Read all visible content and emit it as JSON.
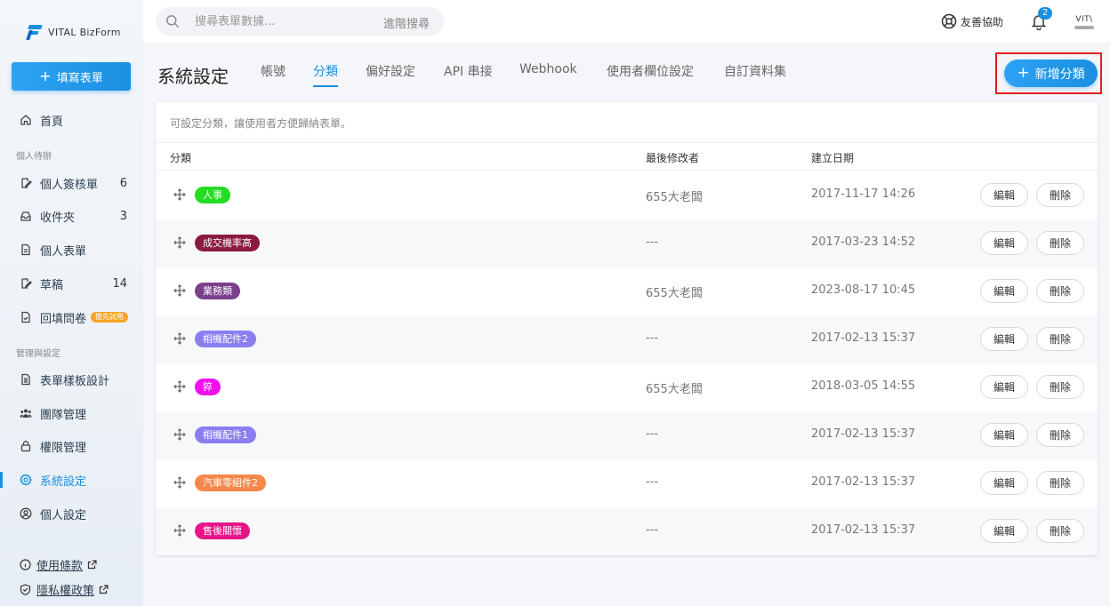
{
  "brand": {
    "name": "VITAL BizForm"
  },
  "sidebar": {
    "fill_button": "填寫表單",
    "home": "首頁",
    "section_personal": "個人待辦",
    "personal_items": [
      {
        "label": "個人簽核單",
        "count": "6",
        "icon": "sign-icon"
      },
      {
        "label": "收件夾",
        "count": "3",
        "icon": "inbox-icon"
      },
      {
        "label": "個人表單",
        "count": "",
        "icon": "document-icon"
      },
      {
        "label": "草稿",
        "count": "14",
        "icon": "draft-icon"
      },
      {
        "label": "回填問卷",
        "count": "",
        "icon": "survey-icon",
        "badge": "搶先試用"
      }
    ],
    "section_admin": "管理與設定",
    "admin_items": [
      {
        "label": "表單樣板設計",
        "icon": "template-icon"
      },
      {
        "label": "團隊管理",
        "icon": "team-icon"
      },
      {
        "label": "權限管理",
        "icon": "lock-icon"
      },
      {
        "label": "系統設定",
        "icon": "gear-icon",
        "active": true
      },
      {
        "label": "個人設定",
        "icon": "user-icon"
      }
    ],
    "footer": {
      "terms": "使用條款",
      "privacy": "隱私權政策"
    }
  },
  "topbar": {
    "search_placeholder": "搜尋表單數據...",
    "advanced_search": "進階搜尋",
    "help": "友善協助",
    "notification_count": "2",
    "avatar_text": "VIT\\"
  },
  "header": {
    "title": "系統設定",
    "tabs": [
      {
        "label": "帳號",
        "active": false
      },
      {
        "label": "分類",
        "active": true
      },
      {
        "label": "偏好設定",
        "active": false
      },
      {
        "label": "API 串接",
        "active": false
      },
      {
        "label": "Webhook",
        "active": false
      },
      {
        "label": "使用者欄位設定",
        "active": false
      },
      {
        "label": "自訂資料集",
        "active": false
      }
    ],
    "add_button": "新增分類"
  },
  "table": {
    "hint": "可設定分類，讓使用者方便歸納表單。",
    "columns": {
      "category": "分類",
      "modifier": "最後修改者",
      "created": "建立日期"
    },
    "edit_label": "編輯",
    "delete_label": "刪除",
    "rows": [
      {
        "tag": "人事",
        "color": "#22dd22",
        "modifier": "655大老闆",
        "created": "2017-11-17 14:26"
      },
      {
        "tag": "成交機率高",
        "color": "#8b1a3e",
        "modifier": "---",
        "created": "2017-03-23 14:52"
      },
      {
        "tag": "業務類",
        "color": "#7b3f8c",
        "modifier": "655大老闆",
        "created": "2023-08-17 10:45"
      },
      {
        "tag": "相機配件2",
        "color": "#8a7ef0",
        "modifier": "---",
        "created": "2017-02-13 15:37"
      },
      {
        "tag": "猝",
        "color": "#ee11ee",
        "modifier": "655大老闆",
        "created": "2018-03-05 14:55"
      },
      {
        "tag": "相機配件1",
        "color": "#8a7ef0",
        "modifier": "---",
        "created": "2017-02-13 15:37"
      },
      {
        "tag": "汽車零組件2",
        "color": "#f5884a",
        "modifier": "---",
        "created": "2017-02-13 15:37"
      },
      {
        "tag": "售後關懷",
        "color": "#e8148a",
        "modifier": "---",
        "created": "2017-02-13 15:37"
      }
    ]
  },
  "colors": {
    "accent": "#1a8fe0",
    "highlight_border": "#e02020"
  }
}
